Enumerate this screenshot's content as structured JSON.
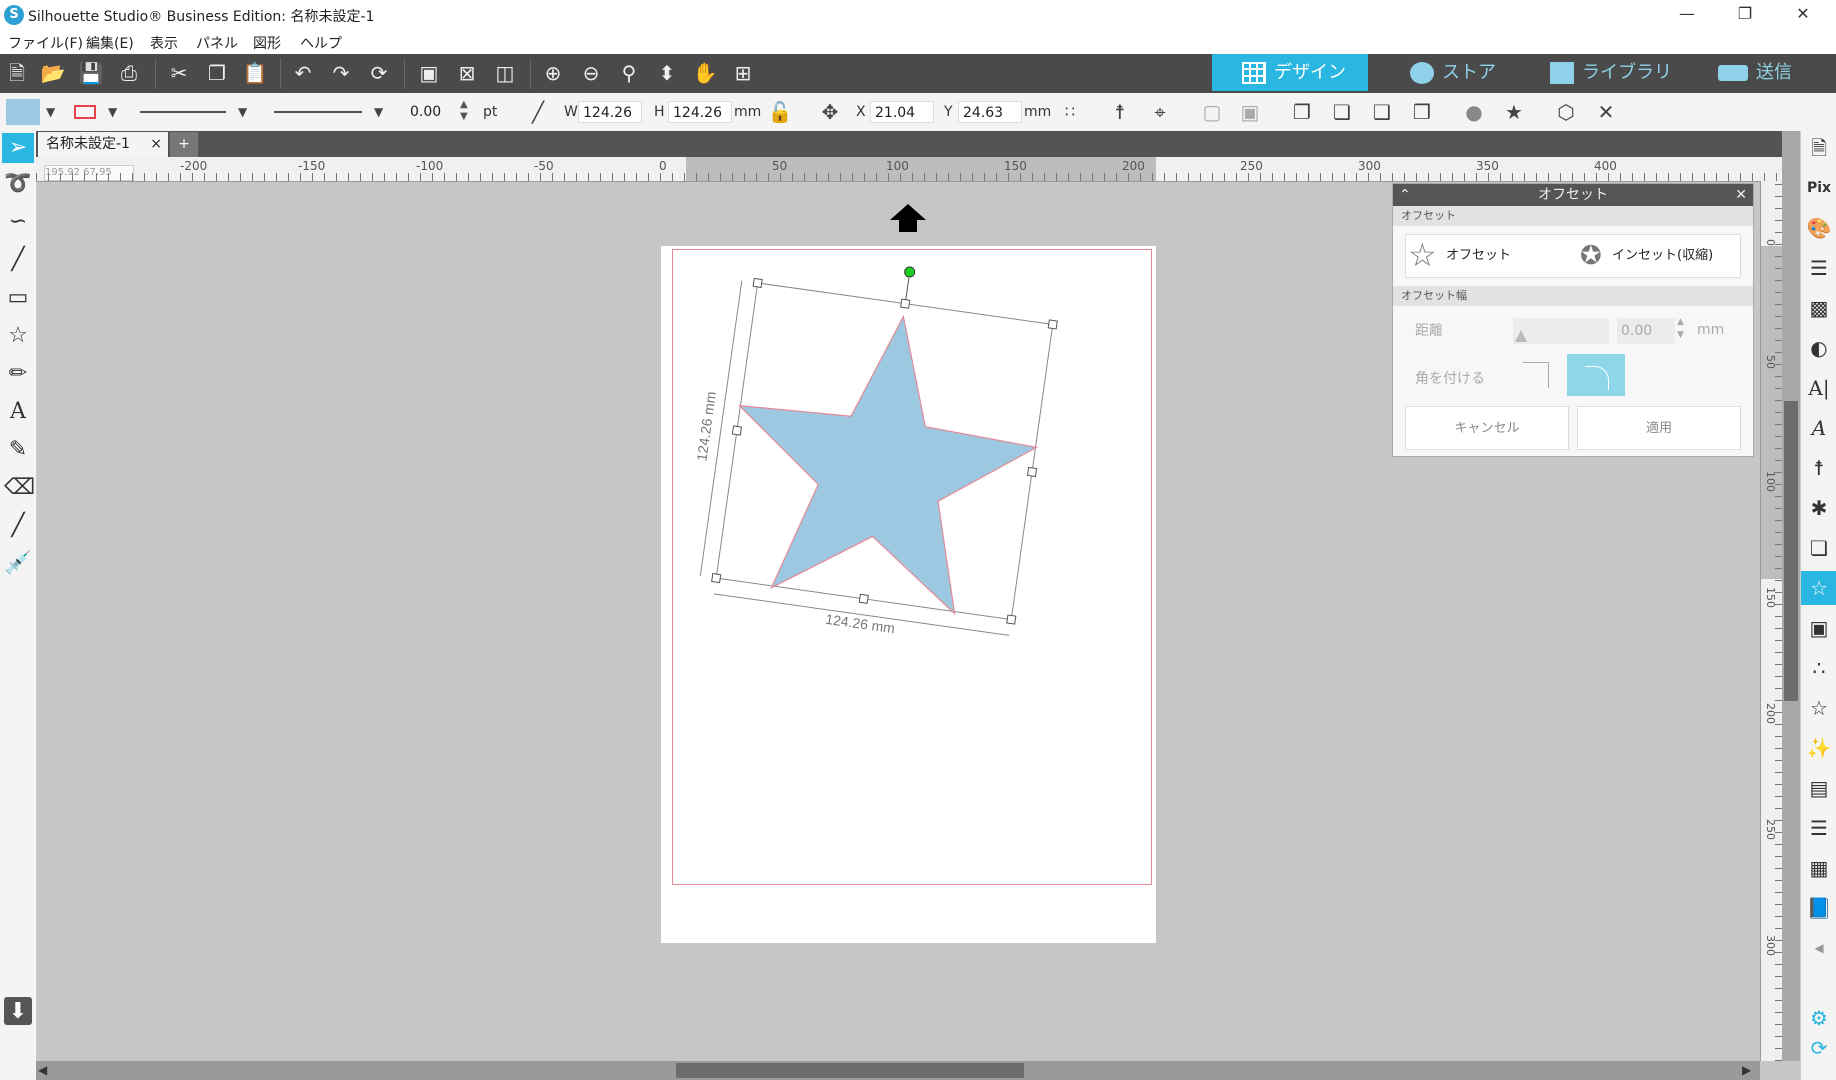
{
  "window": {
    "title": "Silhouette Studio® Business Edition: 名称未設定-1",
    "logo_letter": "S",
    "controls": [
      "—",
      "❐",
      "✕"
    ]
  },
  "menu": [
    "ファイル(F)",
    "編集(E)",
    "表示",
    "パネル",
    "図形",
    "ヘルプ"
  ],
  "nav_tabs": [
    {
      "label": "デザイン",
      "active": true
    },
    {
      "label": "ストア",
      "active": false
    },
    {
      "label": "ライブラリ",
      "active": false
    },
    {
      "label": "送信",
      "active": false
    }
  ],
  "toolbar2": {
    "line_width": "0.00",
    "line_unit": "pt",
    "w_label": "W",
    "w_value": "124.26",
    "h_label": "H",
    "h_value": "124.26",
    "size_unit": "mm",
    "x_label": "X",
    "x_value": "21.04",
    "y_label": "Y",
    "y_value": "24.63",
    "pos_unit": "mm"
  },
  "doc_tab": {
    "name": "名称未設定-1",
    "close": "×",
    "add": "+"
  },
  "ruler": {
    "cursor_readout": "195.92  67.95",
    "h_ticks": [
      "-200",
      "-150",
      "-100",
      "-50",
      "0",
      "50",
      "100",
      "150",
      "200",
      "250",
      "300",
      "350",
      "400"
    ],
    "v_ticks": [
      "0",
      "50",
      "100",
      "150",
      "200",
      "250",
      "300"
    ]
  },
  "shape": {
    "type": "star",
    "fill": "#9dc8e2",
    "stroke": "#e58a96",
    "dimension_w": "124.26 mm",
    "dimension_h": "124.26 mm"
  },
  "offset_panel": {
    "title": "オフセット",
    "section1": "オフセット",
    "offset_button": "オフセット",
    "inset_button": "インセット(収縮)",
    "section2": "オフセット幅",
    "distance_label": "距離",
    "distance_value": "0.00",
    "distance_unit": "mm",
    "corner_label": "角を付ける",
    "cancel": "キャンセル",
    "apply": "適用"
  },
  "colors": {
    "accent": "#29b6e0",
    "fill_swatch": "#9dc8e2",
    "line_swatch": "#e8404c",
    "toolbar_dark": "#4a4a4a"
  }
}
